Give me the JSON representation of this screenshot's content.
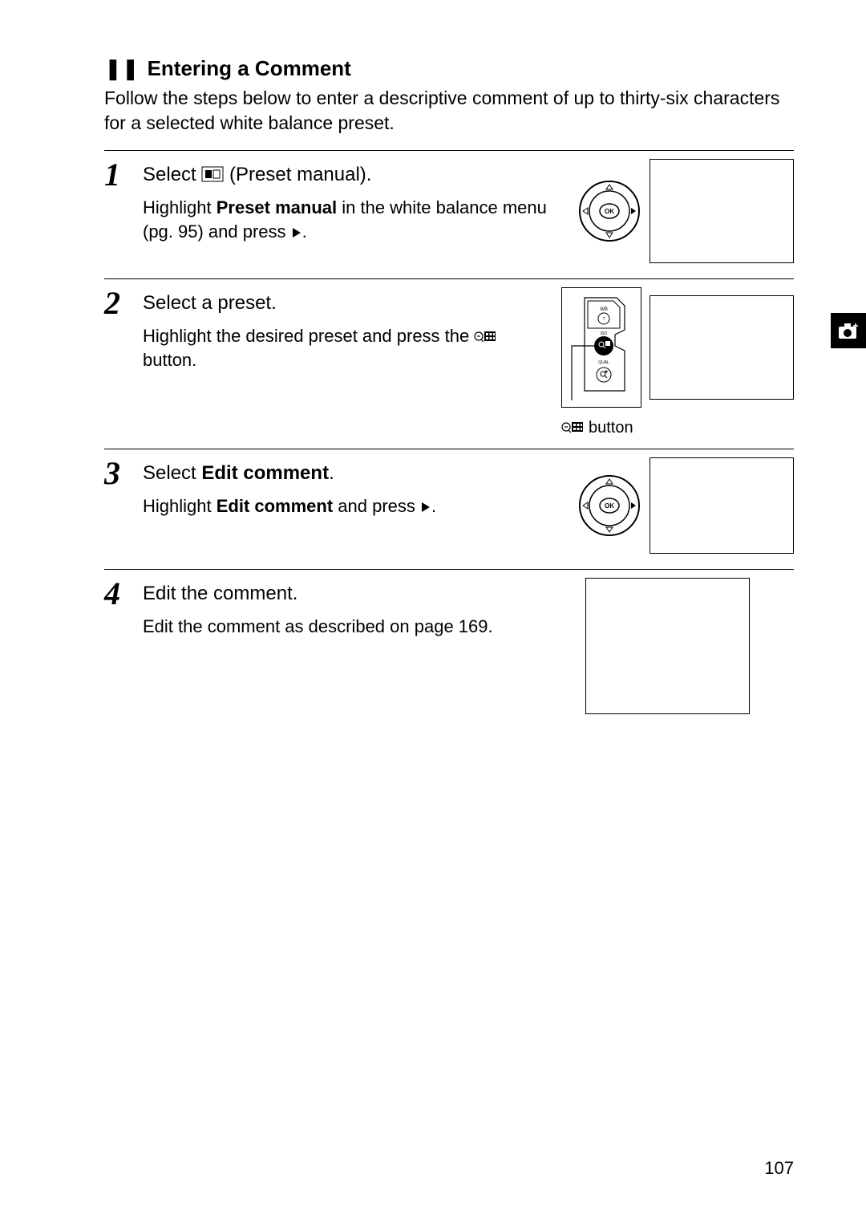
{
  "title_icon": "❚❚",
  "title": "Entering a Comment",
  "intro": "Follow the steps below to enter a descriptive comment of up to thirty-six characters for a selected white balance preset.",
  "steps": [
    {
      "number": "1",
      "heading_pre": "Select ",
      "heading_strong": "",
      "heading_post": "(Preset manual).",
      "detail_a": "Highlight ",
      "detail_b": "Preset manual",
      "detail_c": " in the white balance menu (pg. 95) and press ",
      "detail_d": "."
    },
    {
      "number": "2",
      "heading": "Select a preset.",
      "detail_a": "Highlight the desired preset and press the ",
      "detail_b": " button.",
      "button_caption": " button"
    },
    {
      "number": "3",
      "heading_pre": "Select ",
      "heading_strong": "Edit comment",
      "heading_post": ".",
      "detail_a": "Highlight ",
      "detail_b": "Edit comment",
      "detail_c": " and press ",
      "detail_d": "."
    },
    {
      "number": "4",
      "heading": "Edit the comment.",
      "detail": "Edit the comment as described on page 169."
    }
  ],
  "page_number": "107"
}
